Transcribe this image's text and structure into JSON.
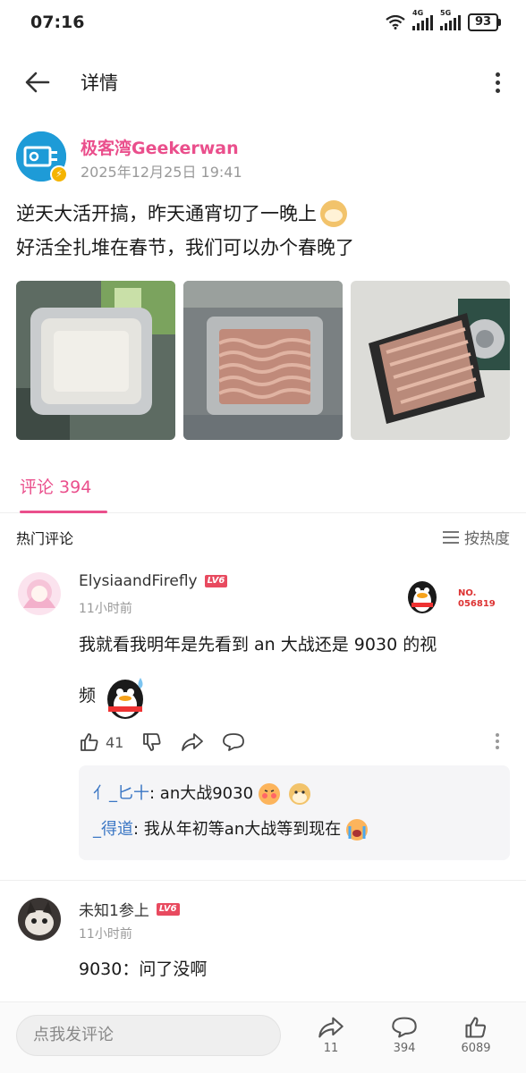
{
  "status_bar": {
    "time": "07:16",
    "network_1": "4G",
    "network_2": "5G",
    "battery": "93"
  },
  "header": {
    "title": "详情"
  },
  "post": {
    "author_name": "极客湾Geekerwan",
    "timestamp": "2025年12月25日 19:41",
    "text_line_1": "逆天大活开搞，昨天通宵切了一晚上",
    "text_line_2": "好活全扎堆在春节，我们可以办个春晚了",
    "images": [
      "cpu-in-clamp",
      "copper-waterblock",
      "cpu-with-cooler"
    ]
  },
  "tabs": {
    "comments_label": "评论 394"
  },
  "hot": {
    "label": "热门评论",
    "sort_label": "按热度"
  },
  "comments": [
    {
      "username": "ElysiaandFirefly",
      "level": "LV6",
      "time": "11小时前",
      "text_line_1": "我就看我明年是先看到 an 大战还是 9030 的视",
      "text_line_2": "频",
      "likes": "41",
      "fan_badge_label": "NO.",
      "fan_badge_number": "056819",
      "replies": [
        {
          "user": "亻_匕十",
          "text": ": an大战9030"
        },
        {
          "user": "_得道",
          "text": ": 我从年初等an大战等到现在"
        }
      ]
    },
    {
      "username": "未知1参上",
      "level": "LV6",
      "time": "11小时前",
      "text": "9030：问了没啊"
    }
  ],
  "bottom_bar": {
    "input_placeholder": "点我发评论",
    "share_count": "11",
    "comment_count": "394",
    "like_count": "6089"
  },
  "colors": {
    "accent_pink": "#ea4f8c",
    "reply_blue": "#3a76c4",
    "level_badge": "#e84a5f"
  }
}
